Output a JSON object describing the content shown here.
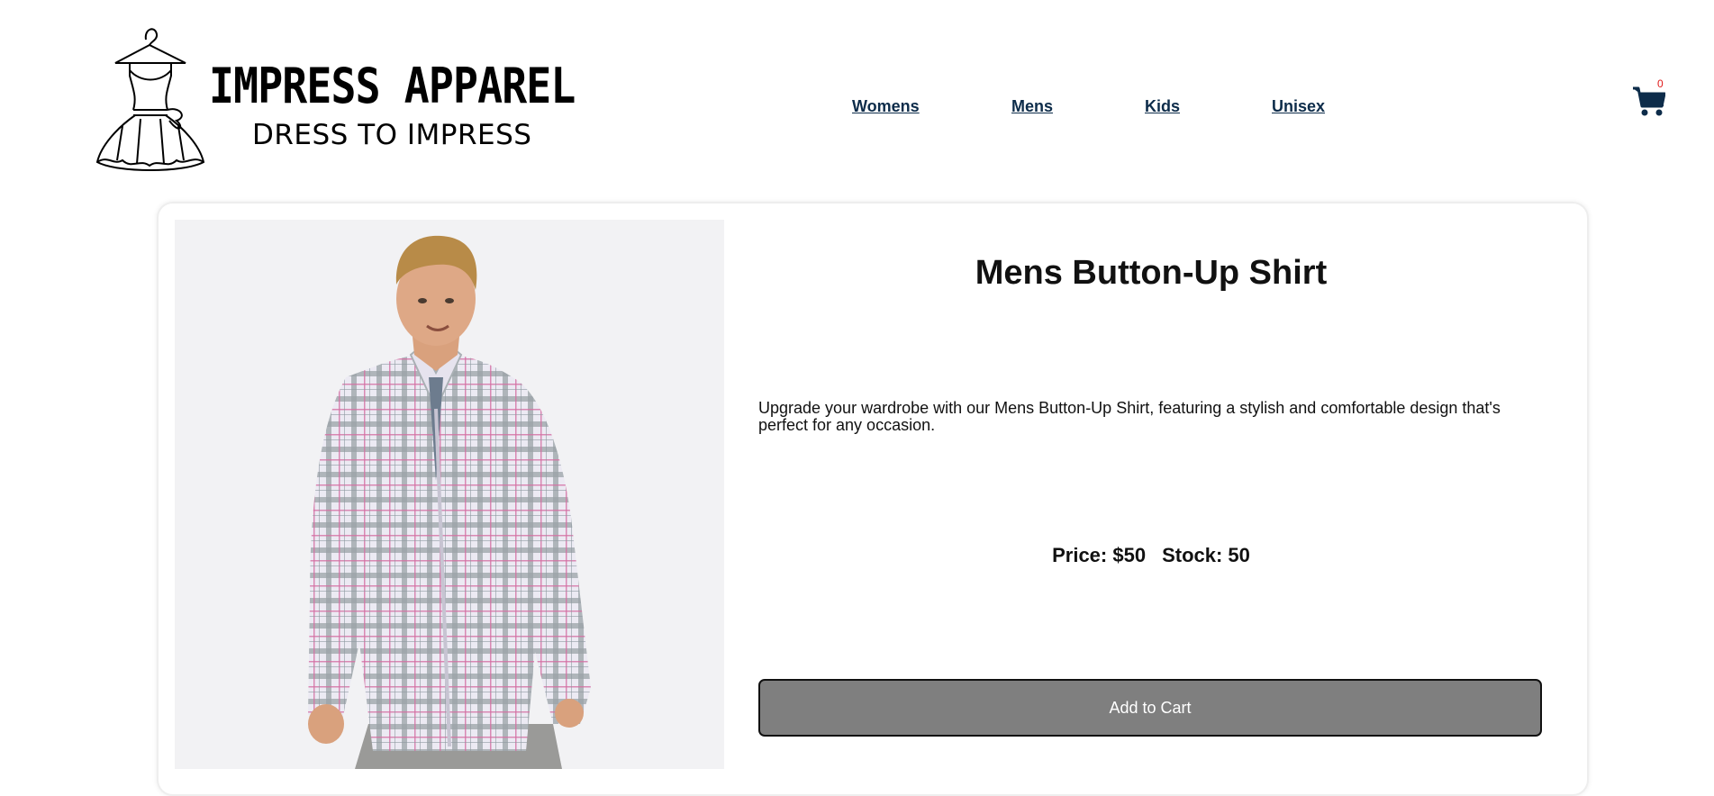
{
  "brand": {
    "name": "IMPRESS APPAREL",
    "tagline": "DRESS TO IMPRESS"
  },
  "nav": {
    "items": [
      {
        "label": "Womens"
      },
      {
        "label": "Mens"
      },
      {
        "label": "Kids"
      },
      {
        "label": "Unisex"
      }
    ]
  },
  "cart": {
    "count": "0",
    "icon": "shopping-cart-icon"
  },
  "product": {
    "title": "Mens Button-Up Shirt",
    "description": "Upgrade your wardrobe with our Mens Button-Up Shirt, featuring a stylish and comfortable design that's perfect for any occasion.",
    "price": "Price: $50",
    "stock": "Stock: 50",
    "add_to_cart_label": "Add to Cart"
  },
  "colors": {
    "nav_link": "#0d2c4a",
    "cart_badge": "#e01a1a",
    "button_bg": "#7f7f7f"
  }
}
